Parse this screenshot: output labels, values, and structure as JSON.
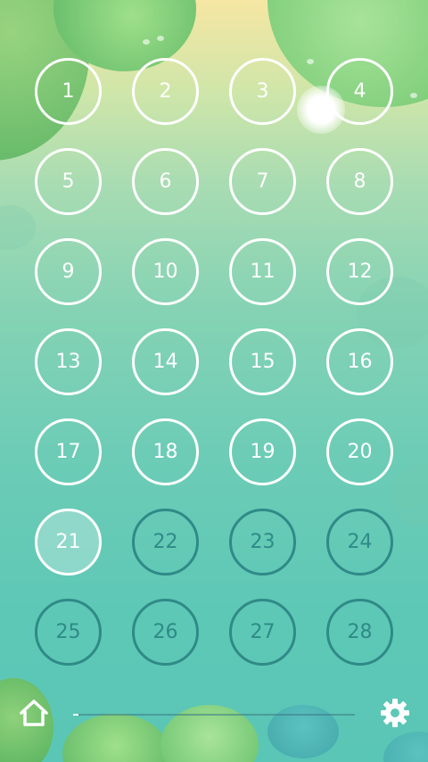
{
  "levels": [
    {
      "number": "1",
      "state": "unlocked"
    },
    {
      "number": "2",
      "state": "unlocked"
    },
    {
      "number": "3",
      "state": "unlocked"
    },
    {
      "number": "4",
      "state": "unlocked"
    },
    {
      "number": "5",
      "state": "unlocked"
    },
    {
      "number": "6",
      "state": "unlocked"
    },
    {
      "number": "7",
      "state": "unlocked"
    },
    {
      "number": "8",
      "state": "unlocked"
    },
    {
      "number": "9",
      "state": "unlocked"
    },
    {
      "number": "10",
      "state": "unlocked"
    },
    {
      "number": "11",
      "state": "unlocked"
    },
    {
      "number": "12",
      "state": "unlocked"
    },
    {
      "number": "13",
      "state": "unlocked"
    },
    {
      "number": "14",
      "state": "unlocked"
    },
    {
      "number": "15",
      "state": "unlocked"
    },
    {
      "number": "16",
      "state": "unlocked"
    },
    {
      "number": "17",
      "state": "unlocked"
    },
    {
      "number": "18",
      "state": "unlocked"
    },
    {
      "number": "19",
      "state": "unlocked"
    },
    {
      "number": "20",
      "state": "unlocked"
    },
    {
      "number": "21",
      "state": "current"
    },
    {
      "number": "22",
      "state": "locked"
    },
    {
      "number": "23",
      "state": "locked"
    },
    {
      "number": "24",
      "state": "locked"
    },
    {
      "number": "25",
      "state": "locked"
    },
    {
      "number": "26",
      "state": "locked"
    },
    {
      "number": "27",
      "state": "locked"
    },
    {
      "number": "28",
      "state": "locked"
    }
  ],
  "bottom_bar": {
    "home_icon": "home-icon",
    "settings_icon": "gear-icon",
    "progress_fraction": 0.02
  },
  "colors": {
    "unlocked_ring": "#ffffff",
    "locked_ring": "#2f8a88"
  }
}
